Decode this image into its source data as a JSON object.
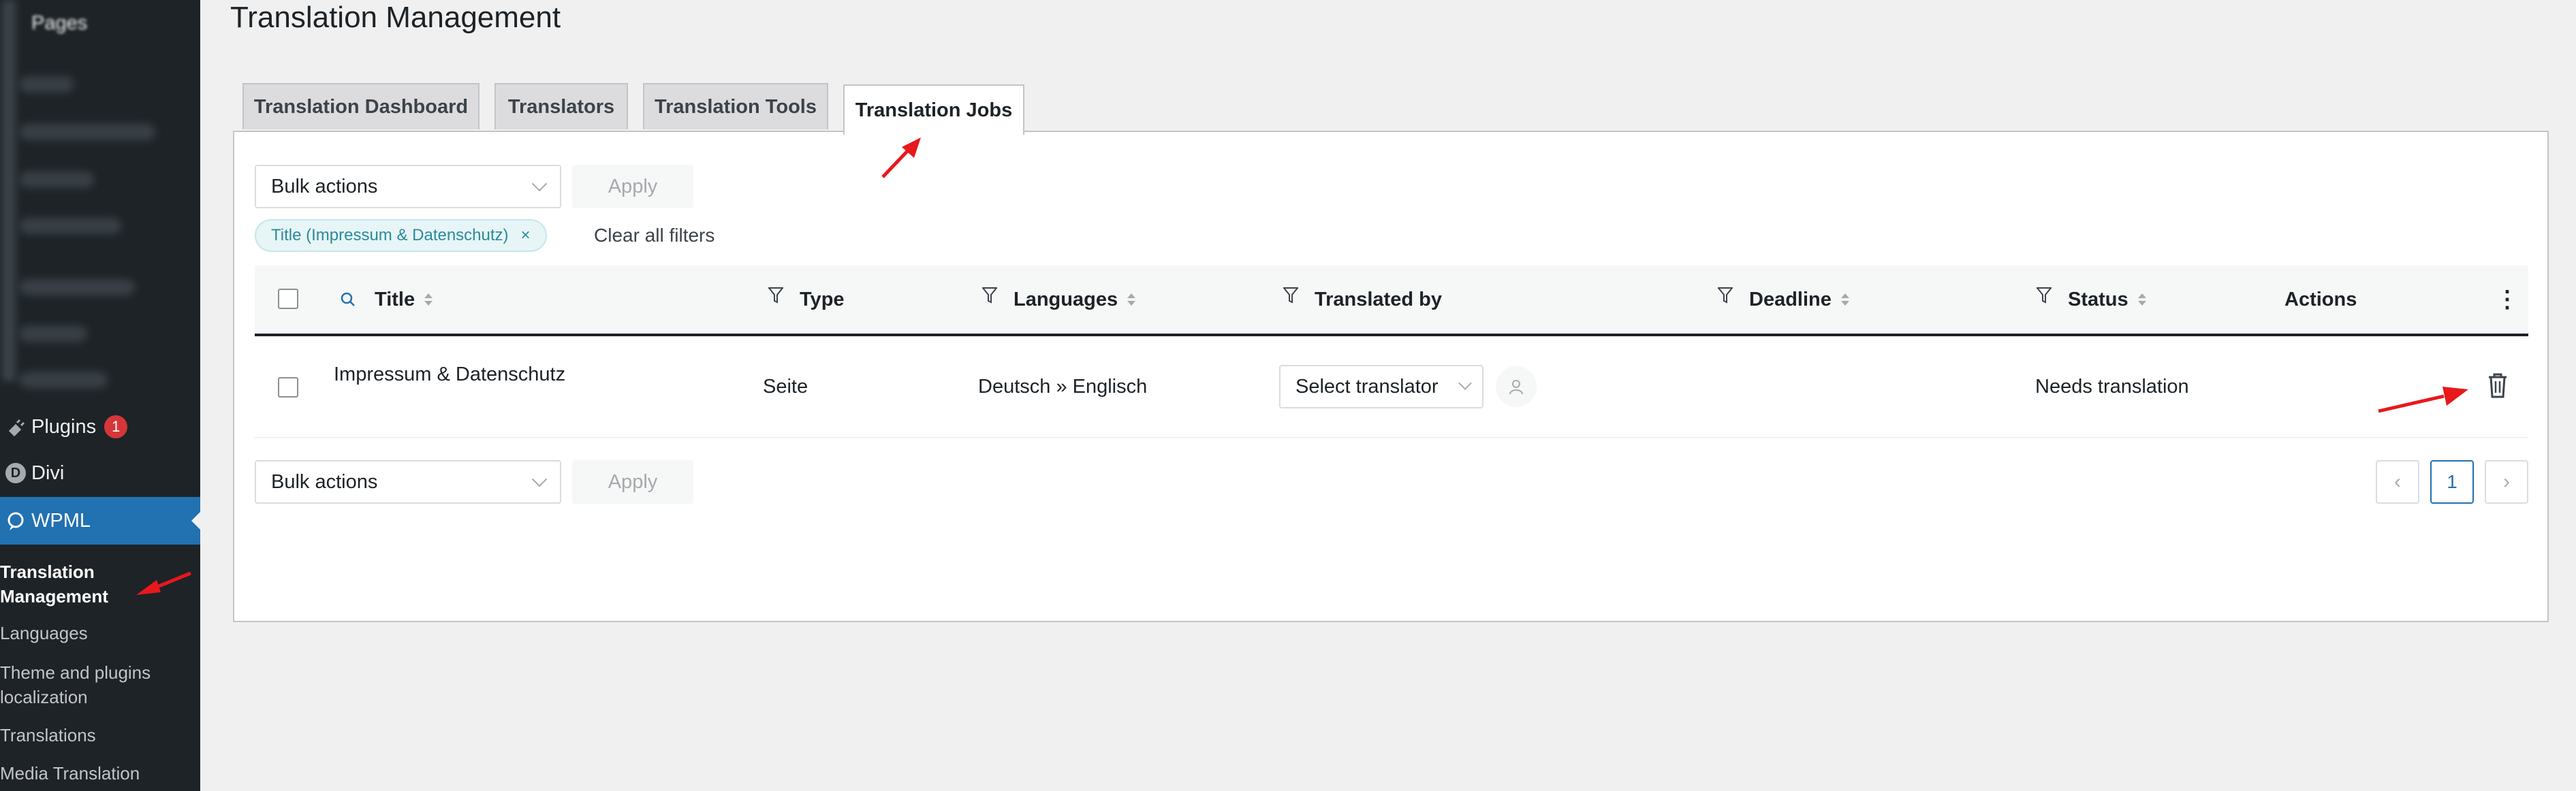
{
  "sidebar": {
    "partial_top_label": "Pages",
    "plugins_label": "Plugins",
    "plugins_badge": "1",
    "divi_label": "Divi",
    "divi_icon_letter": "D",
    "wpml_label": "WPML",
    "submenu": [
      {
        "label": "Translation Management",
        "current": true
      },
      {
        "label": "Languages"
      },
      {
        "label": "Theme and plugins localization"
      },
      {
        "label": "Translations"
      },
      {
        "label": "Media Translation"
      }
    ]
  },
  "page": {
    "title": "Translation Management"
  },
  "tabs": [
    {
      "label": "Translation Dashboard"
    },
    {
      "label": "Translators"
    },
    {
      "label": "Translation Tools"
    },
    {
      "label": "Translation Jobs",
      "active": true
    }
  ],
  "toolbar_top": {
    "bulk_label": "Bulk actions",
    "apply_label": "Apply"
  },
  "filters": {
    "chip_label": "Title (Impressum & Datenschutz)",
    "chip_close": "×",
    "clear_all": "Clear all filters"
  },
  "table": {
    "columns": [
      "Title",
      "Type",
      "Languages",
      "Translated by",
      "Deadline",
      "Status",
      "Actions"
    ],
    "more_menu": "⋮",
    "rows": [
      {
        "title": "Impressum & Datenschutz",
        "type": "Seite",
        "languages": "Deutsch » Englisch",
        "translator_select": "Select translator",
        "status": "Needs translation"
      }
    ]
  },
  "toolbar_bottom": {
    "bulk_label": "Bulk actions",
    "apply_label": "Apply"
  },
  "pagination": {
    "prev": "‹",
    "current": "1",
    "next": "›"
  },
  "colors": {
    "sidebar_bg": "#1d2327",
    "wpml_active": "#2271b1",
    "badge": "#d63638",
    "annotation_arrow": "#e8181b",
    "chip_text": "#2b8a9c"
  }
}
